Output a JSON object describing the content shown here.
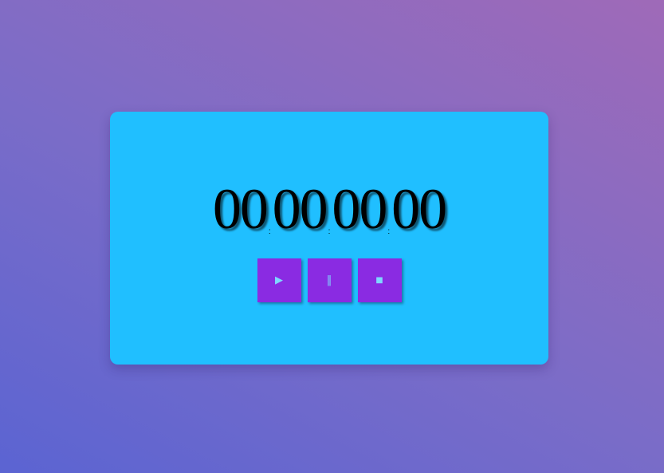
{
  "timer": {
    "hours": "00",
    "minutes": "00",
    "seconds": "00",
    "centiseconds": "00",
    "separator": ":"
  },
  "controls": {
    "start_glyph": "▶",
    "pause_glyph": "‖",
    "stop_glyph": "■"
  },
  "colors": {
    "card_background": "#20bfff",
    "button_background": "#8a2be2",
    "button_glyph": "#7fd7ff",
    "page_gradient_start": "#5b64d2",
    "page_gradient_end": "#9f6ab8"
  },
  "icons": {
    "start": "play-icon",
    "pause": "pause-icon",
    "stop": "stop-icon"
  }
}
